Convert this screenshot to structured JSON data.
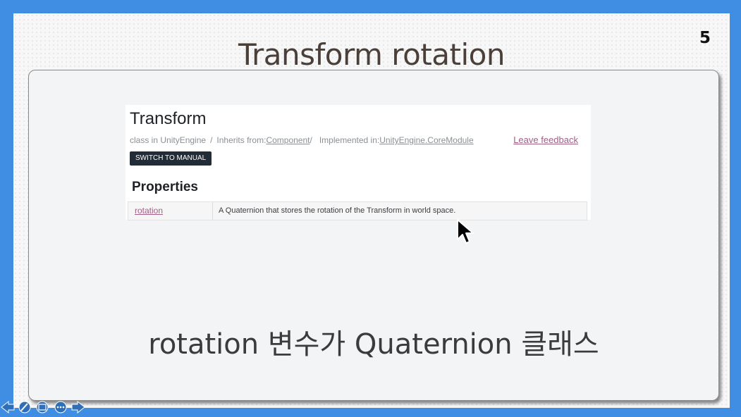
{
  "slide": {
    "title": "Transform rotation",
    "number": "5",
    "caption": "rotation 변수가 Quaternion 클래스"
  },
  "doc": {
    "title": "Transform",
    "class_in": "class in UnityEngine",
    "separator": "/",
    "inherits_label": "Inherits from:",
    "inherits_link": "Component",
    "inherits_trail": "/",
    "implemented_label": "Implemented in:",
    "implemented_link": "UnityEngine.CoreModule",
    "feedback": "Leave feedback",
    "manual_button": "SWITCH TO MANUAL",
    "properties_heading": "Properties",
    "properties": [
      {
        "name": "rotation",
        "description": "A Quaternion that stores the rotation of the Transform in world space."
      }
    ]
  },
  "icons": {
    "cursor": "mouse-pointer-icon",
    "nav": [
      "prev-arrow-icon",
      "pen-icon",
      "slides-icon",
      "more-icon",
      "next-arrow-icon"
    ]
  },
  "colors": {
    "frame": "#3f8ee4",
    "link": "#a15f86",
    "button": "#222c37"
  }
}
